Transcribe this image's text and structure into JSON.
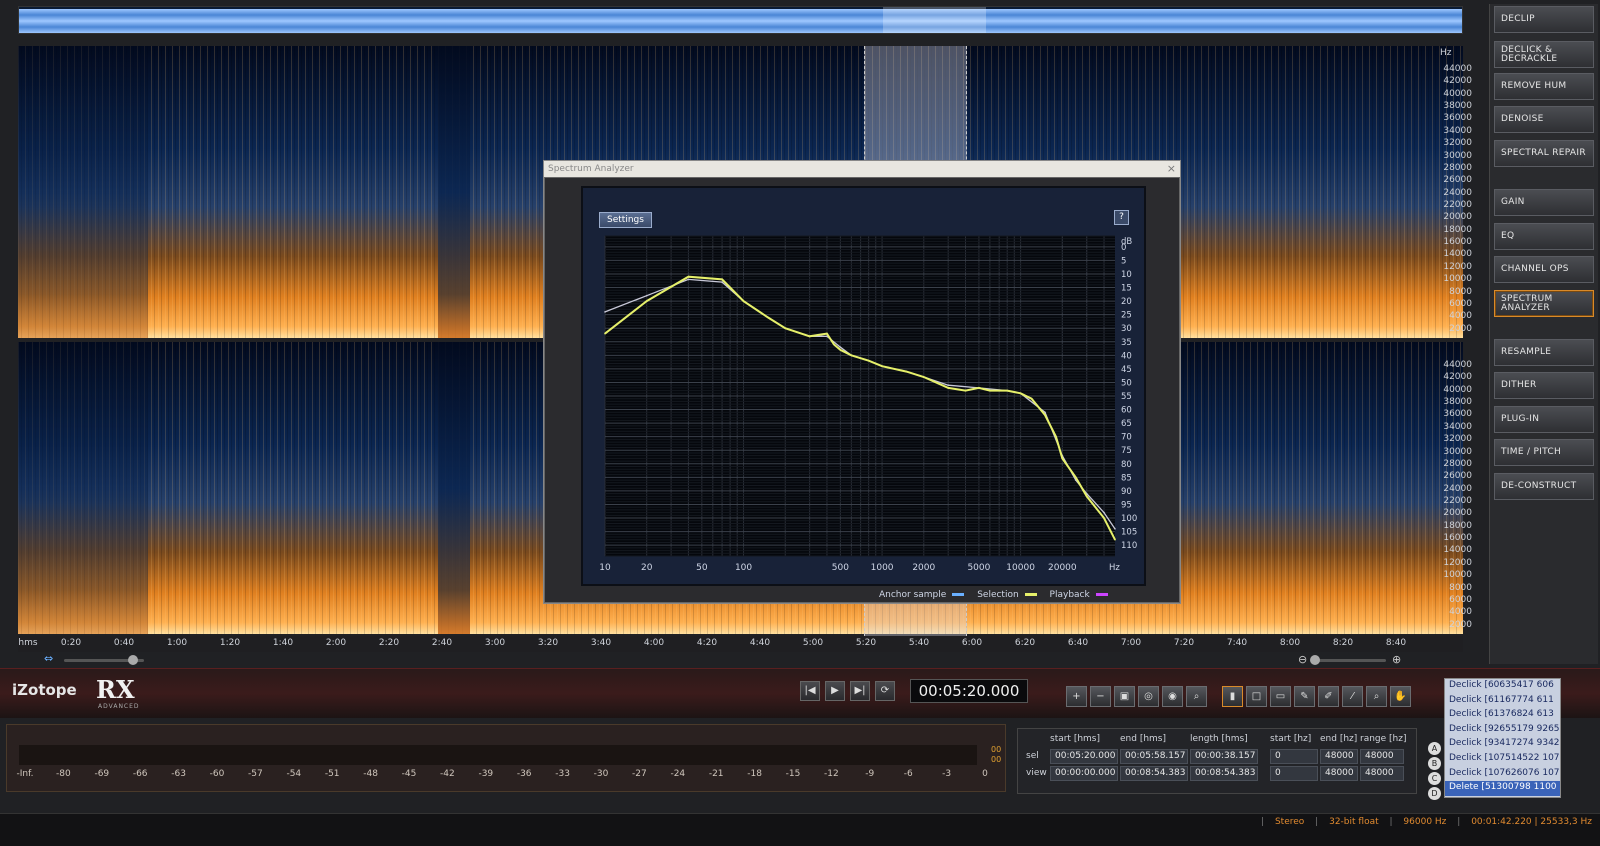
{
  "app": {
    "brand": "iZotope",
    "product": "RX",
    "edition": "ADVANCED"
  },
  "colors": {
    "accent": "#e08a30",
    "spectro_high": "#ffb050",
    "spectro_low": "#0a2550",
    "selection_curve": "#e6f06a",
    "anchor_curve": "#c8c8d8",
    "playback_curve": "#cc44ff",
    "anchor_swatch": "#6ab0ff"
  },
  "spectrogram": {
    "hz_label": "Hz",
    "hz_ticks_top": [
      "44000",
      "42000",
      "40000",
      "38000",
      "36000",
      "34000",
      "32000",
      "30000",
      "28000",
      "26000",
      "24000",
      "22000",
      "20000",
      "18000",
      "16000",
      "14000",
      "12000",
      "10000",
      "8000",
      "6000",
      "4000",
      "2000"
    ],
    "hz_ticks_bottom": [
      "44000",
      "42000",
      "40000",
      "38000",
      "36000",
      "34000",
      "32000",
      "30000",
      "28000",
      "26000",
      "24000",
      "22000",
      "20000",
      "18000",
      "16000",
      "14000",
      "12000",
      "10000",
      "8000",
      "6000",
      "4000",
      "2000"
    ]
  },
  "time_ruler": {
    "unit": "hms",
    "ticks": [
      "0:20",
      "0:40",
      "1:00",
      "1:20",
      "1:40",
      "2:00",
      "2:20",
      "2:40",
      "3:00",
      "3:20",
      "3:40",
      "4:00",
      "4:20",
      "4:40",
      "5:00",
      "5:20",
      "5:40",
      "6:00",
      "6:20",
      "6:40",
      "7:00",
      "7:20",
      "7:40",
      "8:00",
      "8:20",
      "8:40"
    ]
  },
  "modules": [
    {
      "label": "DECLIP",
      "active": false
    },
    {
      "label": "DECLICK & DECRACKLE",
      "active": false
    },
    {
      "label": "REMOVE HUM",
      "active": false
    },
    {
      "label": "DENOISE",
      "active": false
    },
    {
      "label": "SPECTRAL REPAIR",
      "active": false
    },
    {
      "label": "GAIN",
      "active": false
    },
    {
      "label": "EQ",
      "active": false
    },
    {
      "label": "CHANNEL OPS",
      "active": false
    },
    {
      "label": "SPECTRUM ANALYZER",
      "active": true
    },
    {
      "label": "RESAMPLE",
      "active": false
    },
    {
      "label": "DITHER",
      "active": false
    },
    {
      "label": "PLUG-IN",
      "active": false
    },
    {
      "label": "TIME / PITCH",
      "active": false
    },
    {
      "label": "DE-CONSTRUCT",
      "active": false
    }
  ],
  "analyzer": {
    "title": "Spectrum Analyzer",
    "close": "×",
    "settings_label": "Settings",
    "help_label": "?",
    "legend": {
      "anchor": "Anchor sample",
      "selection": "Selection",
      "playback": "Playback"
    }
  },
  "chart_data": {
    "type": "line",
    "title": "",
    "xlabel": "Hz",
    "ylabel": "dB",
    "x_scale": "log",
    "xlim": [
      10,
      48000
    ],
    "ylim": [
      -114,
      4
    ],
    "x_ticks": [
      10,
      20,
      50,
      100,
      500,
      1000,
      2000,
      5000,
      10000,
      20000
    ],
    "x_tick_labels": [
      "10",
      "20",
      "50",
      "100",
      "500",
      "1000",
      "2000",
      "5000",
      "10000",
      "20000"
    ],
    "x_unit_label": "Hz",
    "y_unit_label": "dB",
    "y_ticks": [
      0,
      -5,
      -10,
      -15,
      -20,
      -25,
      -30,
      -35,
      -40,
      -45,
      -50,
      -55,
      -60,
      -65,
      -70,
      -75,
      -80,
      -85,
      -90,
      -95,
      -100,
      -105,
      -110
    ],
    "y_tick_labels": [
      "0",
      "5",
      "10",
      "15",
      "20",
      "25",
      "30",
      "35",
      "40",
      "45",
      "50",
      "55",
      "60",
      "65",
      "70",
      "75",
      "80",
      "85",
      "90",
      "95",
      "100",
      "105",
      "110"
    ],
    "grid": true,
    "series": [
      {
        "name": "Selection",
        "x": [
          10,
          20,
          40,
          70,
          100,
          150,
          200,
          300,
          400,
          450,
          500,
          600,
          800,
          1000,
          1500,
          2000,
          3000,
          4000,
          5000,
          6000,
          8000,
          10000,
          12000,
          15000,
          18000,
          20000,
          25000,
          30000,
          40000,
          48000
        ],
        "y": [
          -32,
          -20,
          -11,
          -12,
          -20,
          -26,
          -30,
          -33,
          -32,
          -36,
          -38,
          -40,
          -42,
          -44,
          -46,
          -48,
          -52,
          -53,
          -52,
          -53,
          -53,
          -54,
          -56,
          -62,
          -70,
          -78,
          -85,
          -92,
          -100,
          -108
        ]
      },
      {
        "name": "Anchor sample",
        "x": [
          10,
          20,
          40,
          70,
          100,
          150,
          200,
          300,
          400,
          500,
          600,
          800,
          1000,
          1500,
          2000,
          3000,
          5000,
          8000,
          10000,
          15000,
          20000,
          25000,
          30000,
          40000,
          48000
        ],
        "y": [
          -24,
          -18,
          -12,
          -13,
          -20,
          -26,
          -30,
          -33,
          -33,
          -37,
          -40,
          -42,
          -44,
          -46,
          -48,
          -51,
          -52,
          -53,
          -54,
          -61,
          -77,
          -86,
          -91,
          -98,
          -104
        ]
      }
    ]
  },
  "transport": {
    "timecode": "00:05:20.000"
  },
  "history": [
    "Declick [60635417 606",
    "Declick [61167774 611",
    "Declick [61376824 613",
    "Declick [92655179 9265",
    "Declick [93417274 9342",
    "Declick [107514522 107",
    "Declick [107626076 107",
    "Delete [51300798 1100"
  ],
  "meter": {
    "peak_top": "00",
    "peak_bottom": "00",
    "scale": [
      "-Inf.",
      "-80",
      "-69",
      "-66",
      "-63",
      "-60",
      "-57",
      "-54",
      "-51",
      "-48",
      "-45",
      "-42",
      "-39",
      "-36",
      "-33",
      "-30",
      "-27",
      "-24",
      "-21",
      "-18",
      "-15",
      "-12",
      "-9",
      "-6",
      "-3",
      "0"
    ]
  },
  "selection_table": {
    "headers": [
      "start [hms]",
      "end [hms]",
      "length [hms]",
      "start [hz]",
      "end [hz]",
      "range [hz]"
    ],
    "rows": [
      {
        "label": "sel",
        "values": [
          "00:05:20.000",
          "00:05:58.157",
          "00:00:38.157",
          "0",
          "48000",
          "48000"
        ]
      },
      {
        "label": "view",
        "values": [
          "00:00:00.000",
          "00:08:54.383",
          "00:08:54.383",
          "0",
          "48000",
          "48000"
        ]
      }
    ]
  },
  "ab_buttons": [
    "A",
    "B",
    "C",
    "D"
  ],
  "status": {
    "channels": "Stereo",
    "bit_depth": "32-bit float",
    "sample_rate": "96000 Hz",
    "cursor": "00:01:42.220 | 25533,3 Hz"
  }
}
